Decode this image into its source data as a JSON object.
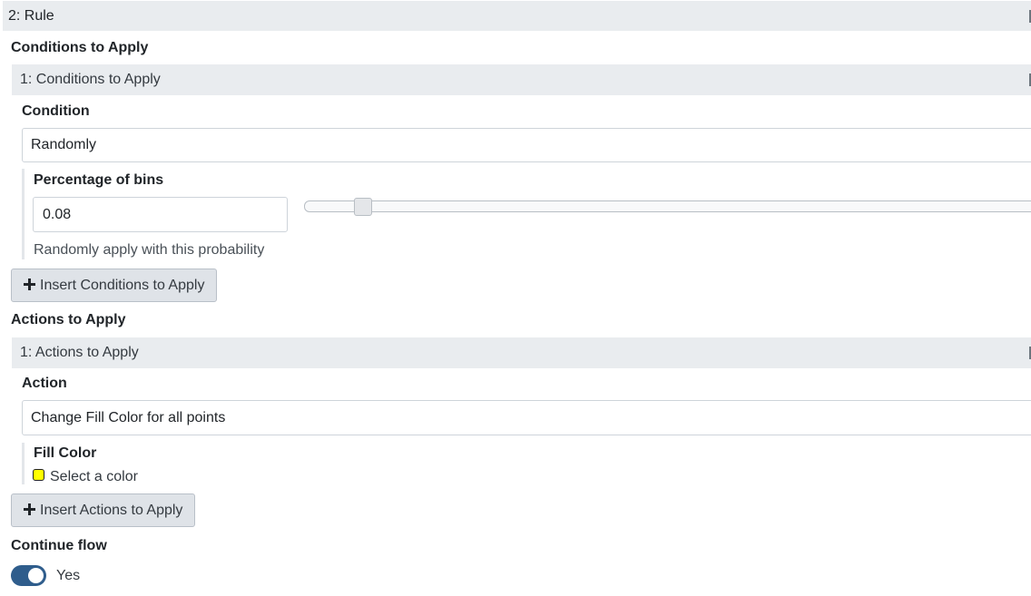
{
  "rule": {
    "header": "2: Rule"
  },
  "conditions": {
    "section_label": "Conditions to Apply",
    "item_header": "1: Conditions to Apply",
    "condition_label": "Condition",
    "condition_value": "Randomly",
    "percentage_label": "Percentage of bins",
    "percentage_value": "0.08",
    "slider_fraction": 0.08,
    "help_text": "Randomly apply with this probability",
    "insert_button": "Insert Conditions to Apply"
  },
  "actions": {
    "section_label": "Actions to Apply",
    "item_header": "1: Actions to Apply",
    "action_label": "Action",
    "action_value": "Change Fill Color for all points",
    "fill_color_label": "Fill Color",
    "fill_color_text": "Select a color",
    "fill_color_value": "#ffff00",
    "insert_button": "Insert Actions to Apply"
  },
  "continue_flow": {
    "label": "Continue flow",
    "toggle_on": true,
    "toggle_text": "Yes"
  }
}
